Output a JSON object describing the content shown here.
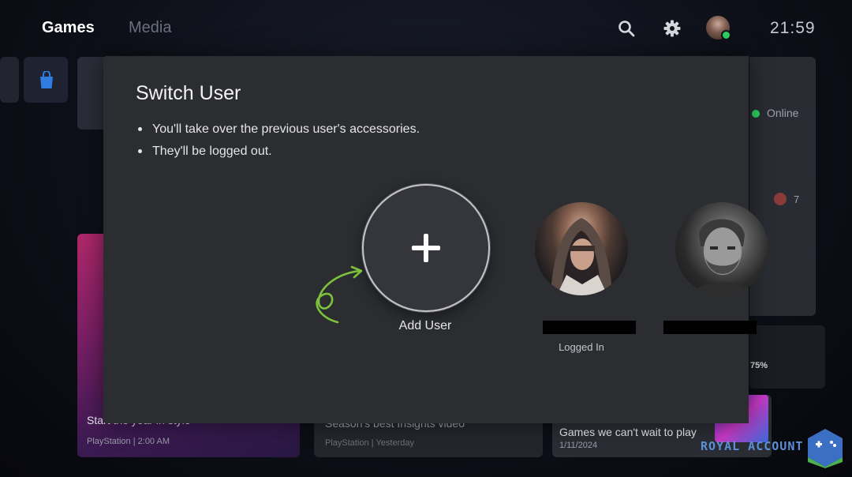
{
  "nav": {
    "games": "Games",
    "media": "Media",
    "clock": "21:59"
  },
  "icons": {
    "search": "search-icon",
    "settings": "gear-icon",
    "store": "playstation-store-icon",
    "plus": "plus-icon"
  },
  "dialog": {
    "title": "Switch User",
    "bullets": [
      "You'll take over the previous user's accessories.",
      "They'll be logged out."
    ],
    "add_user_label": "Add User",
    "users": [
      {
        "status": "Logged In"
      },
      {
        "status": ""
      }
    ]
  },
  "side": {
    "online": "Online",
    "trophy_count": "7",
    "progress": "75%"
  },
  "cards": [
    {
      "title": "Start the year in style",
      "source": "PlayStation",
      "time": "2:00 AM"
    },
    {
      "title": "Season's best Insights video",
      "source": "PlayStation",
      "time": "Yesterday"
    },
    {
      "title": "Games we can't wait to play",
      "date": "1/11/2024"
    }
  ],
  "watermark": "ROYAL ACCOUNT",
  "colors": {
    "online": "#2bd160",
    "dialog_bg": "#2b2d31",
    "annotation_arrow": "#7dc23b",
    "watermark": "#5c8fd6"
  }
}
